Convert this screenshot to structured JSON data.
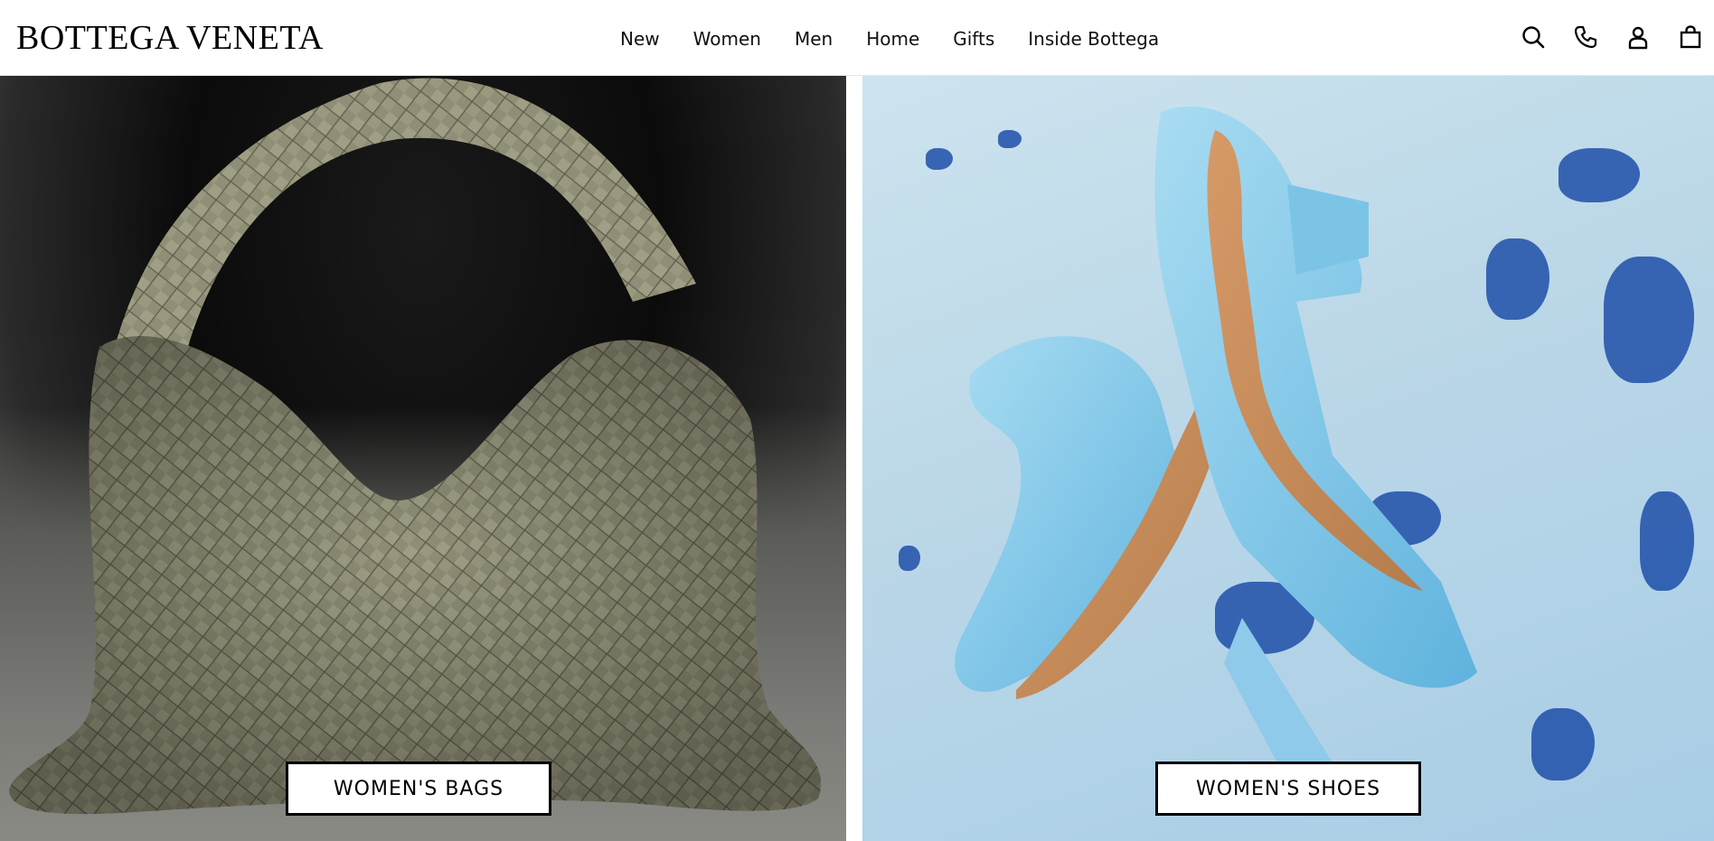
{
  "header": {
    "logo": "BOTTEGA VENETA",
    "nav": [
      "New",
      "Women",
      "Men",
      "Home",
      "Gifts",
      "Inside Bottega"
    ],
    "icons": [
      "search-icon",
      "phone-icon",
      "account-icon",
      "bag-icon"
    ]
  },
  "panels": {
    "left": {
      "cta_label": "WOMEN'S BAGS",
      "image": "woven-hobo-bag"
    },
    "right": {
      "cta_label": "WOMEN'S SHOES",
      "image": "blue-heeled-sandals"
    }
  },
  "colors": {
    "bag": "#8f8e76",
    "shoe": "#7cc4e6",
    "paint": "#1f4fa8"
  }
}
